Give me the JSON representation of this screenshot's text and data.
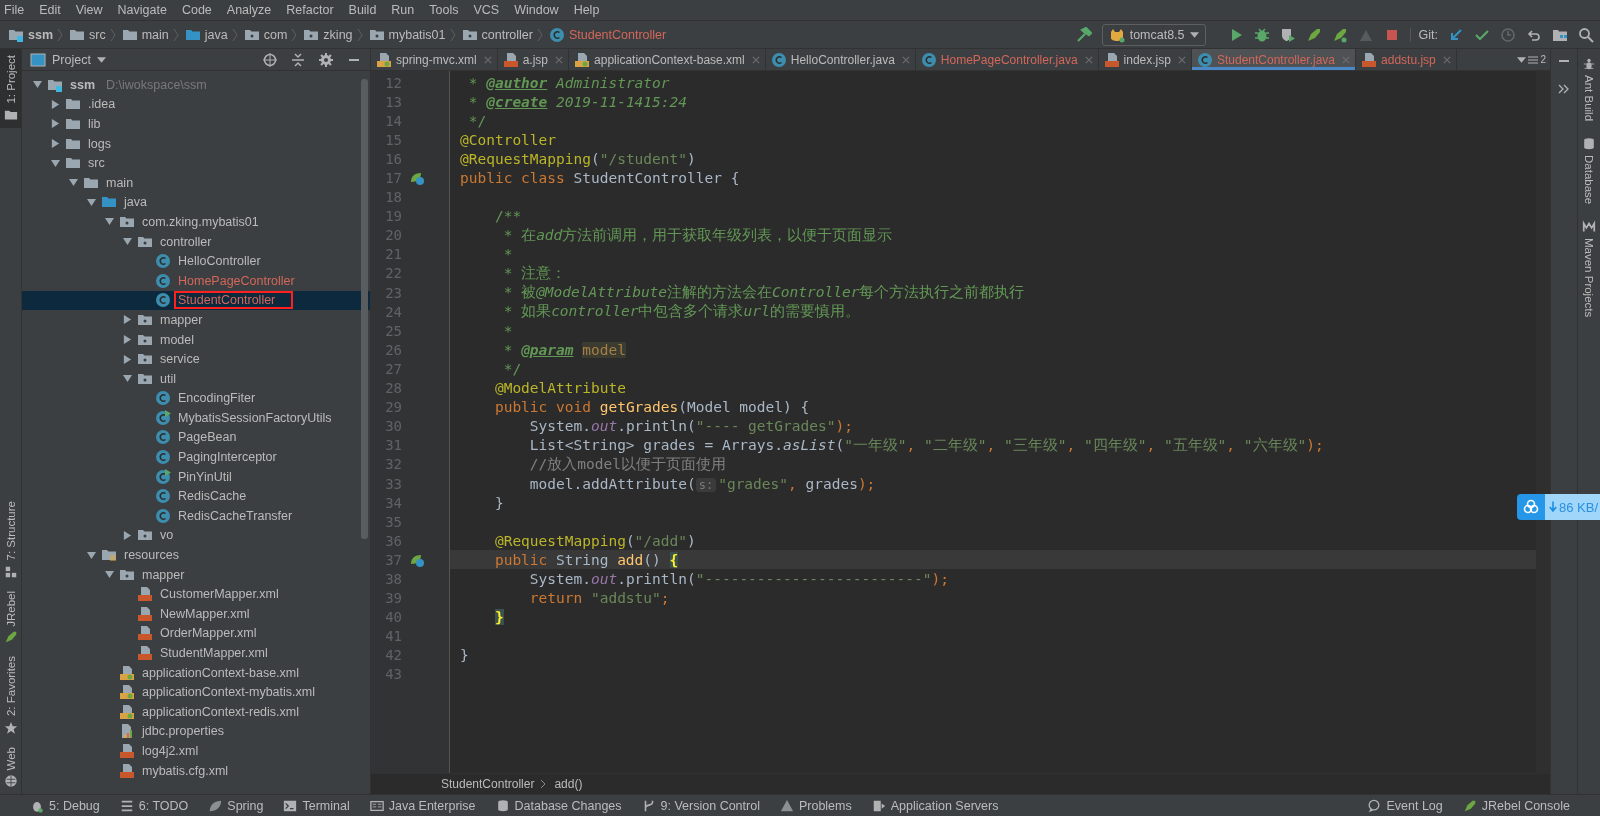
{
  "menu": [
    "File",
    "Edit",
    "View",
    "Navigate",
    "Code",
    "Analyze",
    "Refactor",
    "Build",
    "Run",
    "Tools",
    "VCS",
    "Window",
    "Help"
  ],
  "navbar": {
    "crumbs": [
      {
        "label": "ssm",
        "kind": "module",
        "unversioned": false
      },
      {
        "label": "src",
        "kind": "folder",
        "unversioned": false
      },
      {
        "label": "main",
        "kind": "folder",
        "unversioned": false
      },
      {
        "label": "java",
        "kind": "source",
        "unversioned": false
      },
      {
        "label": "com",
        "kind": "package",
        "unversioned": false
      },
      {
        "label": "zking",
        "kind": "package",
        "unversioned": false
      },
      {
        "label": "mybatis01",
        "kind": "package",
        "unversioned": false
      },
      {
        "label": "controller",
        "kind": "package",
        "unversioned": false
      },
      {
        "label": "StudentController",
        "kind": "class",
        "unversioned": true
      }
    ],
    "toolbar": [
      {
        "kind": "build",
        "disabled": false
      },
      {
        "kind": "runconfig",
        "label": "tomcat8.5"
      },
      {
        "kind": "run",
        "disabled": false
      },
      {
        "kind": "debug",
        "disabled": false
      },
      {
        "kind": "coverage",
        "disabled": false
      },
      {
        "kind": "jrebel_run",
        "disabled": false
      },
      {
        "kind": "jrebel_debug",
        "disabled": false
      },
      {
        "kind": "profile",
        "disabled": true
      },
      {
        "kind": "stop",
        "disabled": false
      },
      {
        "kind": "text",
        "label": "Git:"
      },
      {
        "kind": "update",
        "disabled": false
      },
      {
        "kind": "commit",
        "disabled": false
      },
      {
        "kind": "history",
        "disabled": true
      },
      {
        "kind": "revert",
        "disabled": false
      },
      {
        "kind": "structure",
        "disabled": false
      },
      {
        "kind": "search",
        "disabled": false
      }
    ]
  },
  "left_strip_top": [
    {
      "label": "1: Project",
      "kind": "folder",
      "selected": true
    }
  ],
  "left_strip_bottom": [
    {
      "label": "7: Structure",
      "kind": "structure",
      "selected": false
    },
    {
      "label": "JRebel",
      "kind": "jrebel",
      "selected": false
    },
    {
      "label": "2: Favorites",
      "kind": "star",
      "selected": false
    },
    {
      "label": "Web",
      "kind": "globe",
      "selected": false
    }
  ],
  "project": {
    "title": "Project",
    "tree": [
      {
        "label": "ssm",
        "detail": "D:\\iwokspace\\ssm",
        "kind": "module",
        "expanded": true,
        "selected": false,
        "annotated": false,
        "unversioned": false,
        "children": [
          {
            "label": ".idea",
            "kind": "folder",
            "expanded": false,
            "selected": false,
            "annotated": false,
            "unversioned": false
          },
          {
            "label": "lib",
            "kind": "folder",
            "expanded": false,
            "selected": false,
            "annotated": false,
            "unversioned": false
          },
          {
            "label": "logs",
            "kind": "folder",
            "expanded": false,
            "selected": false,
            "annotated": false,
            "unversioned": false
          },
          {
            "label": "src",
            "kind": "folder",
            "expanded": true,
            "selected": false,
            "annotated": false,
            "unversioned": false,
            "children": [
              {
                "label": "main",
                "kind": "folder",
                "expanded": true,
                "selected": false,
                "annotated": false,
                "unversioned": false,
                "children": [
                  {
                    "label": "java",
                    "kind": "source",
                    "expanded": true,
                    "selected": false,
                    "annotated": false,
                    "unversioned": false,
                    "children": [
                      {
                        "label": "com.zking.mybatis01",
                        "kind": "package",
                        "expanded": true,
                        "selected": false,
                        "annotated": false,
                        "unversioned": false,
                        "children": [
                          {
                            "label": "controller",
                            "kind": "package",
                            "expanded": true,
                            "selected": false,
                            "annotated": false,
                            "unversioned": false,
                            "children": [
                              {
                                "label": "HelloController",
                                "kind": "class",
                                "selected": false,
                                "annotated": false,
                                "unversioned": false
                              },
                              {
                                "label": "HomePageController",
                                "kind": "class",
                                "selected": false,
                                "annotated": false,
                                "unversioned": true
                              },
                              {
                                "label": "StudentController",
                                "kind": "class",
                                "selected": true,
                                "annotated": true,
                                "unversioned": true
                              }
                            ]
                          },
                          {
                            "label": "mapper",
                            "kind": "package",
                            "expanded": false,
                            "selected": false,
                            "annotated": false,
                            "unversioned": false
                          },
                          {
                            "label": "model",
                            "kind": "package",
                            "expanded": false,
                            "selected": false,
                            "annotated": false,
                            "unversioned": false
                          },
                          {
                            "label": "service",
                            "kind": "package",
                            "expanded": false,
                            "selected": false,
                            "annotated": false,
                            "unversioned": false
                          },
                          {
                            "label": "util",
                            "kind": "package",
                            "expanded": true,
                            "selected": false,
                            "annotated": false,
                            "unversioned": false,
                            "children": [
                              {
                                "label": "EncodingFiter",
                                "kind": "class",
                                "selected": false,
                                "annotated": false,
                                "unversioned": false
                              },
                              {
                                "label": "MybatisSessionFactoryUtils",
                                "kind": "class_main",
                                "selected": false,
                                "annotated": false,
                                "unversioned": false
                              },
                              {
                                "label": "PageBean",
                                "kind": "class",
                                "selected": false,
                                "annotated": false,
                                "unversioned": false
                              },
                              {
                                "label": "PagingInterceptor",
                                "kind": "class",
                                "selected": false,
                                "annotated": false,
                                "unversioned": false
                              },
                              {
                                "label": "PinYinUtil",
                                "kind": "class_main",
                                "selected": false,
                                "annotated": false,
                                "unversioned": false
                              },
                              {
                                "label": "RedisCache",
                                "kind": "class",
                                "selected": false,
                                "annotated": false,
                                "unversioned": false
                              },
                              {
                                "label": "RedisCacheTransfer",
                                "kind": "class",
                                "selected": false,
                                "annotated": false,
                                "unversioned": false
                              }
                            ]
                          },
                          {
                            "label": "vo",
                            "kind": "package",
                            "expanded": false,
                            "selected": false,
                            "annotated": false,
                            "unversioned": false
                          }
                        ]
                      }
                    ]
                  },
                  {
                    "label": "resources",
                    "kind": "resources",
                    "expanded": true,
                    "selected": false,
                    "annotated": false,
                    "unversioned": false,
                    "children": [
                      {
                        "label": "mapper",
                        "kind": "package",
                        "expanded": true,
                        "selected": false,
                        "annotated": false,
                        "unversioned": false,
                        "children": [
                          {
                            "label": "CustomerMapper.xml",
                            "kind": "xml",
                            "selected": false,
                            "annotated": false,
                            "unversioned": false
                          },
                          {
                            "label": "NewMapper.xml",
                            "kind": "xml",
                            "selected": false,
                            "annotated": false,
                            "unversioned": false
                          },
                          {
                            "label": "OrderMapper.xml",
                            "kind": "xml",
                            "selected": false,
                            "annotated": false,
                            "unversioned": false
                          },
                          {
                            "label": "StudentMapper.xml",
                            "kind": "xml",
                            "selected": false,
                            "annotated": false,
                            "unversioned": false
                          }
                        ]
                      },
                      {
                        "label": "applicationContext-base.xml",
                        "kind": "spring_xml",
                        "selected": false,
                        "annotated": false,
                        "unversioned": false
                      },
                      {
                        "label": "applicationContext-mybatis.xml",
                        "kind": "spring_xml",
                        "selected": false,
                        "annotated": false,
                        "unversioned": false
                      },
                      {
                        "label": "applicationContext-redis.xml",
                        "kind": "spring_xml",
                        "selected": false,
                        "annotated": false,
                        "unversioned": false
                      },
                      {
                        "label": "jdbc.properties",
                        "kind": "properties",
                        "selected": false,
                        "annotated": false,
                        "unversioned": false
                      },
                      {
                        "label": "log4j2.xml",
                        "kind": "xml",
                        "selected": false,
                        "annotated": false,
                        "unversioned": false
                      },
                      {
                        "label": "mybatis.cfg.xml",
                        "kind": "xml",
                        "selected": false,
                        "annotated": false,
                        "unversioned": false
                      }
                    ]
                  }
                ]
              }
            ]
          }
        ]
      }
    ]
  },
  "tabs": [
    {
      "label": "spring-mvc.xml",
      "kind": "spring_xml",
      "selected": false,
      "unversioned": false
    },
    {
      "label": "a.jsp",
      "kind": "jsp",
      "selected": false,
      "unversioned": false
    },
    {
      "label": "applicationContext-base.xml",
      "kind": "spring_xml",
      "selected": false,
      "unversioned": false
    },
    {
      "label": "HelloController.java",
      "kind": "class",
      "selected": false,
      "unversioned": false
    },
    {
      "label": "HomePageController.java",
      "kind": "class",
      "selected": false,
      "unversioned": true
    },
    {
      "label": "index.jsp",
      "kind": "jsp",
      "selected": false,
      "unversioned": false
    },
    {
      "label": "StudentController.java",
      "kind": "class",
      "selected": true,
      "unversioned": true
    },
    {
      "label": "addstu.jsp",
      "kind": "jsp",
      "selected": false,
      "unversioned": true
    }
  ],
  "hidden_tabs": "2",
  "editor": {
    "lines": [
      {
        "num": "12",
        "current": false,
        "tokens": [
          {
            "kind": "doc",
            "text": " * "
          },
          {
            "kind": "doctag",
            "text": "@author"
          },
          {
            "kind": "doc_code",
            "text": " Administrator"
          }
        ]
      },
      {
        "num": "13",
        "current": false,
        "tokens": [
          {
            "kind": "doc",
            "text": " * "
          },
          {
            "kind": "doctag",
            "text": "@create"
          },
          {
            "kind": "doc_code",
            "text": " 2019-11-1415:24"
          }
        ]
      },
      {
        "num": "14",
        "current": false,
        "tokens": [
          {
            "kind": "doc",
            "text": " */"
          }
        ]
      },
      {
        "num": "15",
        "current": false,
        "tokens": [
          {
            "kind": "annotation",
            "text": "@Controller"
          }
        ]
      },
      {
        "num": "16",
        "current": false,
        "tokens": [
          {
            "kind": "annotation",
            "text": "@RequestMapping"
          },
          {
            "kind": "plain",
            "text": "("
          },
          {
            "kind": "string",
            "text": "\"/student\""
          },
          {
            "kind": "plain",
            "text": ")"
          }
        ]
      },
      {
        "num": "17",
        "current": false,
        "bean": true,
        "tokens": [
          {
            "kind": "keyword",
            "text": "public class "
          },
          {
            "kind": "plain",
            "text": "StudentController {"
          }
        ]
      },
      {
        "num": "18",
        "current": false
      },
      {
        "num": "19",
        "current": false,
        "tokens": [
          {
            "kind": "doc",
            "text": "    /**"
          }
        ]
      },
      {
        "num": "20",
        "current": false,
        "tokens": [
          {
            "kind": "doc",
            "text": "     * 在"
          },
          {
            "kind": "doc_code",
            "text": "add"
          },
          {
            "kind": "doc",
            "text": "方法前调用，用于获取年级列表，以便于页面显示"
          }
        ]
      },
      {
        "num": "21",
        "current": false,
        "tokens": [
          {
            "kind": "doc",
            "text": "     *"
          }
        ]
      },
      {
        "num": "22",
        "current": false,
        "tokens": [
          {
            "kind": "doc",
            "text": "     * 注意："
          }
        ]
      },
      {
        "num": "23",
        "current": false,
        "tokens": [
          {
            "kind": "doc",
            "text": "     * 被"
          },
          {
            "kind": "doc_code",
            "text": "@ModelAttribute"
          },
          {
            "kind": "doc",
            "text": "注解的方法会在"
          },
          {
            "kind": "doc_code",
            "text": "Controller"
          },
          {
            "kind": "doc",
            "text": "每个方法执行之前都执行"
          }
        ]
      },
      {
        "num": "24",
        "current": false,
        "tokens": [
          {
            "kind": "doc",
            "text": "     * 如果"
          },
          {
            "kind": "doc_code",
            "text": "controller"
          },
          {
            "kind": "doc",
            "text": "中包含多个请求"
          },
          {
            "kind": "doc_code",
            "text": "url"
          },
          {
            "kind": "doc",
            "text": "的需要慎用。"
          }
        ]
      },
      {
        "num": "25",
        "current": false,
        "tokens": [
          {
            "kind": "doc",
            "text": "     *"
          }
        ]
      },
      {
        "num": "26",
        "current": false,
        "tokens": [
          {
            "kind": "doc",
            "text": "     * "
          },
          {
            "kind": "doctag",
            "text": "@param"
          },
          {
            "kind": "param",
            "text": " model"
          }
        ]
      },
      {
        "num": "27",
        "current": false,
        "tokens": [
          {
            "kind": "doc",
            "text": "     */"
          }
        ]
      },
      {
        "num": "28",
        "current": false,
        "tokens": [
          {
            "kind": "annotation",
            "text": "    @ModelAttribute"
          }
        ]
      },
      {
        "num": "29",
        "current": false,
        "tokens": [
          {
            "kind": "keyword",
            "text": "    public void "
          },
          {
            "kind": "method",
            "text": "getGrades"
          },
          {
            "kind": "plain",
            "text": "(Model model) {"
          }
        ]
      },
      {
        "num": "30",
        "current": false,
        "tokens": [
          {
            "kind": "plain",
            "text": "        System."
          },
          {
            "kind": "field",
            "text": "out"
          },
          {
            "kind": "plain",
            "text": ".println("
          },
          {
            "kind": "string",
            "text": "\"---- getGrades\""
          },
          {
            "kind": "punct",
            "text": ");"
          }
        ]
      },
      {
        "num": "31",
        "current": false,
        "tokens": [
          {
            "kind": "plain",
            "text": "        List<String> grades = Arrays."
          },
          {
            "kind": "static",
            "text": "asList"
          },
          {
            "kind": "plain",
            "text": "("
          },
          {
            "kind": "string",
            "text": "\"一年级\""
          },
          {
            "kind": "punct",
            "text": ", "
          },
          {
            "kind": "string",
            "text": "\"二年级\""
          },
          {
            "kind": "punct",
            "text": ", "
          },
          {
            "kind": "string",
            "text": "\"三年级\""
          },
          {
            "kind": "punct",
            "text": ", "
          },
          {
            "kind": "string",
            "text": "\"四年级\""
          },
          {
            "kind": "punct",
            "text": ", "
          },
          {
            "kind": "string",
            "text": "\"五年级\""
          },
          {
            "kind": "punct",
            "text": ", "
          },
          {
            "kind": "string",
            "text": "\"六年级\""
          },
          {
            "kind": "punct",
            "text": ");"
          }
        ]
      },
      {
        "num": "32",
        "current": false,
        "tokens": [
          {
            "kind": "comment",
            "text": "        //放入model以便于页面使用"
          }
        ]
      },
      {
        "num": "33",
        "current": false,
        "tokens": [
          {
            "kind": "plain",
            "text": "        model.addAttribute("
          },
          {
            "kind": "hint",
            "text": "s:"
          },
          {
            "kind": "string",
            "text": "\"grades\""
          },
          {
            "kind": "punct",
            "text": ", "
          },
          {
            "kind": "plain",
            "text": "grades"
          },
          {
            "kind": "punct",
            "text": ");"
          }
        ]
      },
      {
        "num": "34",
        "current": false,
        "tokens": [
          {
            "kind": "plain",
            "text": "    }"
          }
        ]
      },
      {
        "num": "35",
        "current": false
      },
      {
        "num": "36",
        "current": false,
        "tokens": [
          {
            "kind": "annotation",
            "text": "    @RequestMapping"
          },
          {
            "kind": "plain",
            "text": "("
          },
          {
            "kind": "string",
            "text": "\"/add\""
          },
          {
            "kind": "plain",
            "text": ")"
          }
        ]
      },
      {
        "num": "37",
        "current": true,
        "bean": true,
        "tokens": [
          {
            "kind": "keyword",
            "text": "    public "
          },
          {
            "kind": "plain",
            "text": "String "
          },
          {
            "kind": "method",
            "text": "add"
          },
          {
            "kind": "plain",
            "text": "() "
          },
          {
            "kind": "brace",
            "text": "{"
          }
        ]
      },
      {
        "num": "38",
        "current": false,
        "tokens": [
          {
            "kind": "plain",
            "text": "        System."
          },
          {
            "kind": "field",
            "text": "out"
          },
          {
            "kind": "plain",
            "text": ".println("
          },
          {
            "kind": "string",
            "text": "\"-------------------------\""
          },
          {
            "kind": "punct",
            "text": ");"
          }
        ]
      },
      {
        "num": "39",
        "current": false,
        "tokens": [
          {
            "kind": "keyword",
            "text": "        return "
          },
          {
            "kind": "string",
            "text": "\"addstu\""
          },
          {
            "kind": "punct",
            "text": ";"
          }
        ]
      },
      {
        "num": "40",
        "current": false,
        "tokens": [
          {
            "kind": "brace",
            "text": "    }"
          }
        ]
      },
      {
        "num": "41",
        "current": false
      },
      {
        "num": "42",
        "current": false,
        "tokens": [
          {
            "kind": "plain",
            "text": "}"
          }
        ]
      },
      {
        "num": "43",
        "current": false
      }
    ],
    "breadcrumb": [
      "StudentController",
      "add()"
    ]
  },
  "right_strip": [
    {
      "label": "Ant Build",
      "kind": "ant"
    },
    {
      "label": "Database",
      "kind": "database"
    },
    {
      "label": "Maven Projects",
      "kind": "maven"
    }
  ],
  "download_widget": {
    "speed": "86 KB/"
  },
  "bottom_tools_left": [
    {
      "label": "5: Debug",
      "kind": "debug"
    },
    {
      "label": "6: TODO",
      "kind": "todo"
    },
    {
      "label": "Spring",
      "kind": "leaf"
    },
    {
      "label": "Terminal",
      "kind": "terminal"
    },
    {
      "label": "Java Enterprise",
      "kind": "ee"
    },
    {
      "label": "Database Changes",
      "kind": "database"
    },
    {
      "label": "9: Version Control",
      "kind": "vcs"
    },
    {
      "label": "Problems",
      "kind": "warning"
    },
    {
      "label": "Application Servers",
      "kind": "server"
    }
  ],
  "bottom_tools_right": [
    {
      "label": "Event Log",
      "kind": "log"
    },
    {
      "label": "JRebel Console",
      "kind": "jrebel"
    }
  ]
}
